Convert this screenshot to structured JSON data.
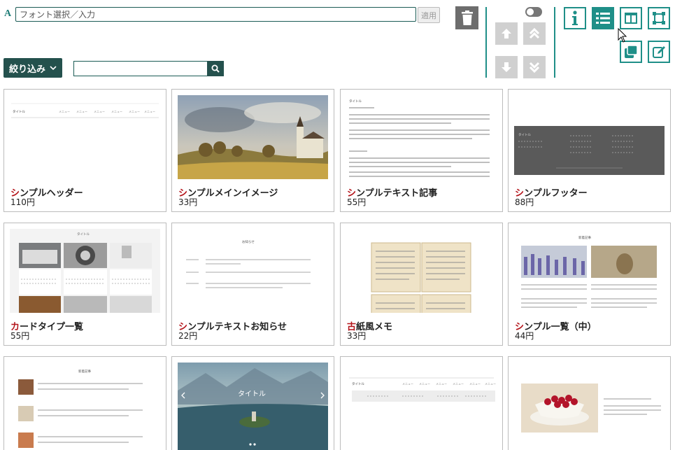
{
  "toolbar": {
    "font_icon_label": "A",
    "font_placeholder": "フォント選択／入力",
    "apply_label": "適用",
    "filter_label": "絞り込み",
    "search_placeholder": ""
  },
  "cards": [
    {
      "first": "シ",
      "rest": "ンプルヘッダー",
      "price": "110円",
      "thumb": "header"
    },
    {
      "first": "シ",
      "rest": "ンプルメインイメージ",
      "price": "33円",
      "thumb": "main-image"
    },
    {
      "first": "シ",
      "rest": "ンプルテキスト記事",
      "price": "55円",
      "thumb": "text-article"
    },
    {
      "first": "シ",
      "rest": "ンプルフッター",
      "price": "88円",
      "thumb": "footer"
    },
    {
      "first": "カ",
      "rest": "ードタイプ一覧",
      "price": "55円",
      "thumb": "card-list"
    },
    {
      "first": "シ",
      "rest": "ンプルテキストお知らせ",
      "price": "22円",
      "thumb": "text-news"
    },
    {
      "first": "古",
      "rest": "紙風メモ",
      "price": "33円",
      "thumb": "paper-memo"
    },
    {
      "first": "シ",
      "rest": "ンプル一覧（中）",
      "price": "44円",
      "thumb": "list-medium"
    },
    {
      "first": "",
      "rest": "",
      "price": "",
      "thumb": "news-list"
    },
    {
      "first": "",
      "rest": "",
      "price": "",
      "thumb": "slider"
    },
    {
      "first": "",
      "rest": "",
      "price": "",
      "thumb": "menu"
    },
    {
      "first": "",
      "rest": "",
      "price": "",
      "thumb": "product"
    }
  ],
  "thumb_text": {
    "title": "タイトル",
    "menu": "メニュー",
    "slider_title": "タイトル",
    "news_heading": "お知らせ",
    "list_heading": "新着記事"
  },
  "colors": {
    "accent": "#1f8f88",
    "dark": "#24514d",
    "highlight": "#b4151b"
  }
}
